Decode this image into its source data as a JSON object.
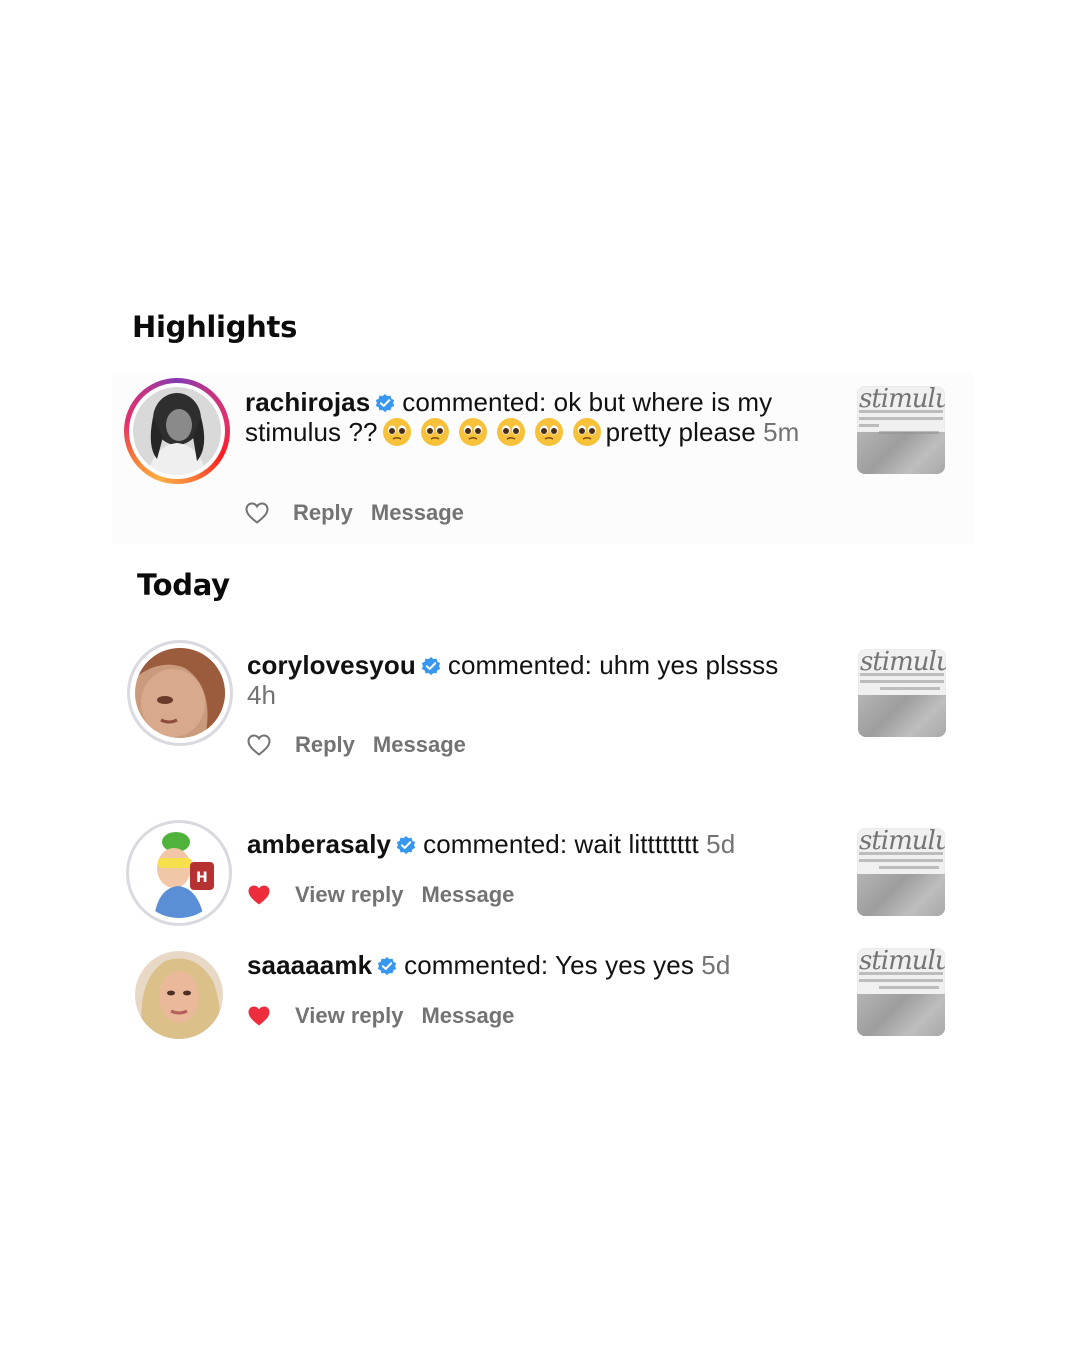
{
  "sections": {
    "highlights_title": "Highlights",
    "today_title": "Today"
  },
  "thumbnail": {
    "script_text": "stimulus"
  },
  "notifications": [
    {
      "username": "rachirojas",
      "text": "commented: ok but where is my stimulus ??",
      "text_after_emoji": "pretty please",
      "emoji_count": 6,
      "time": "5m",
      "actions": [
        "Reply",
        "Message"
      ],
      "liked": false
    },
    {
      "username": "corylovesyou",
      "text": "commented: uhm yes plssss",
      "time": "4h",
      "actions": [
        "Reply",
        "Message"
      ],
      "liked": false
    },
    {
      "username": "amberasaly",
      "text": "commented: wait litttttttt",
      "time": "5d",
      "actions": [
        "View reply",
        "Message"
      ],
      "liked": true
    },
    {
      "username": "saaaaamk",
      "text": "commented: Yes yes yes",
      "time": "5d",
      "actions": [
        "View reply",
        "Message"
      ],
      "liked": true
    }
  ],
  "colors": {
    "verified": "#3897f0",
    "liked_heart": "#ed2d3b",
    "secondary_text": "#737373"
  }
}
